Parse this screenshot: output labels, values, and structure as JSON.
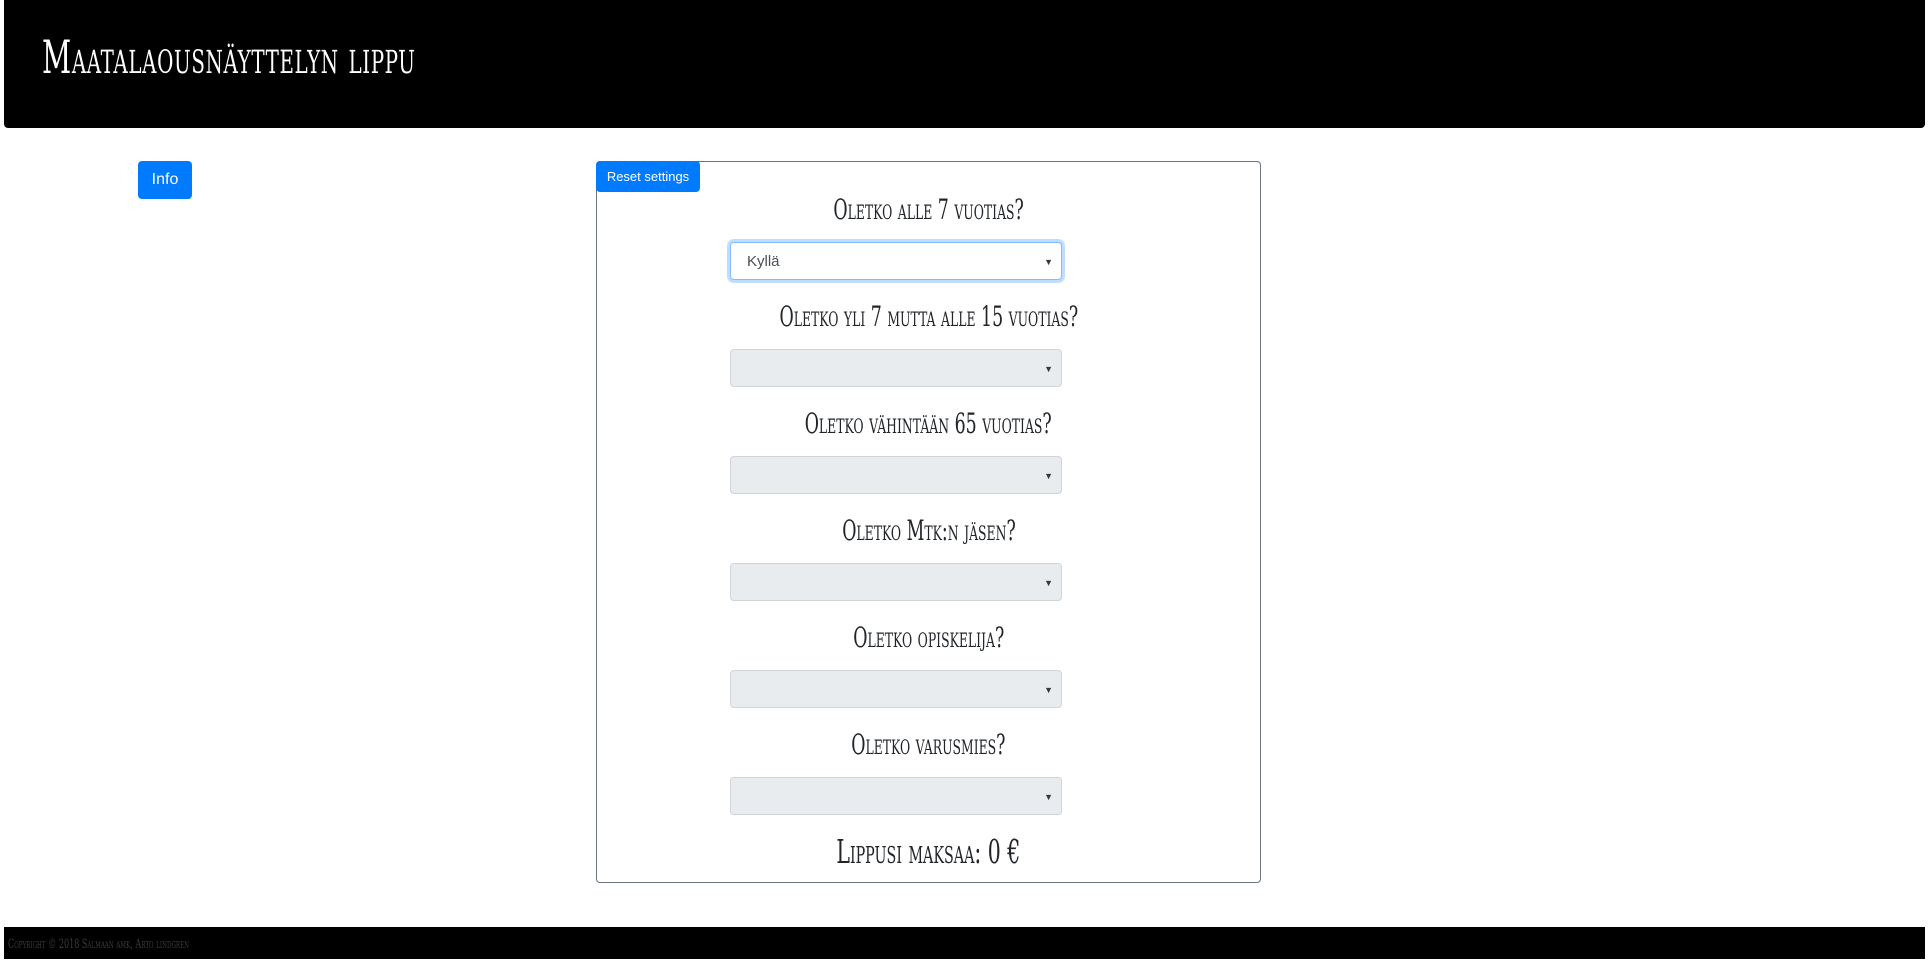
{
  "header": {
    "title": "Maatalaousnäyttelyn lippu"
  },
  "info_button": {
    "label": "Info"
  },
  "form": {
    "reset_label": "Reset settings",
    "questions": [
      {
        "label": "Oletko alle 7 vuotias?",
        "selected": "Kyllä",
        "enabled": true
      },
      {
        "label": "Oletko yli 7 mutta alle 15 vuotias?",
        "selected": "",
        "enabled": false
      },
      {
        "label": "Oletko vähintään 65 vuotias?",
        "selected": "",
        "enabled": false
      },
      {
        "label": "Oletko Mtk:n jäsen?",
        "selected": "",
        "enabled": false
      },
      {
        "label": "Oletko opiskelija?",
        "selected": "",
        "enabled": false
      },
      {
        "label": "Oletko varusmies?",
        "selected": "",
        "enabled": false
      }
    ],
    "price_label": "Lippusi maksaa: 0 €"
  },
  "footer": {
    "text": "Copyright © 2018 Salmaan amk, Arto lindgren"
  },
  "icons": {
    "select_caret": "caret-down-icon"
  },
  "colors": {
    "primary": "#007bff",
    "header_bg": "#000000",
    "disabled_select_bg": "#e9ecef"
  }
}
